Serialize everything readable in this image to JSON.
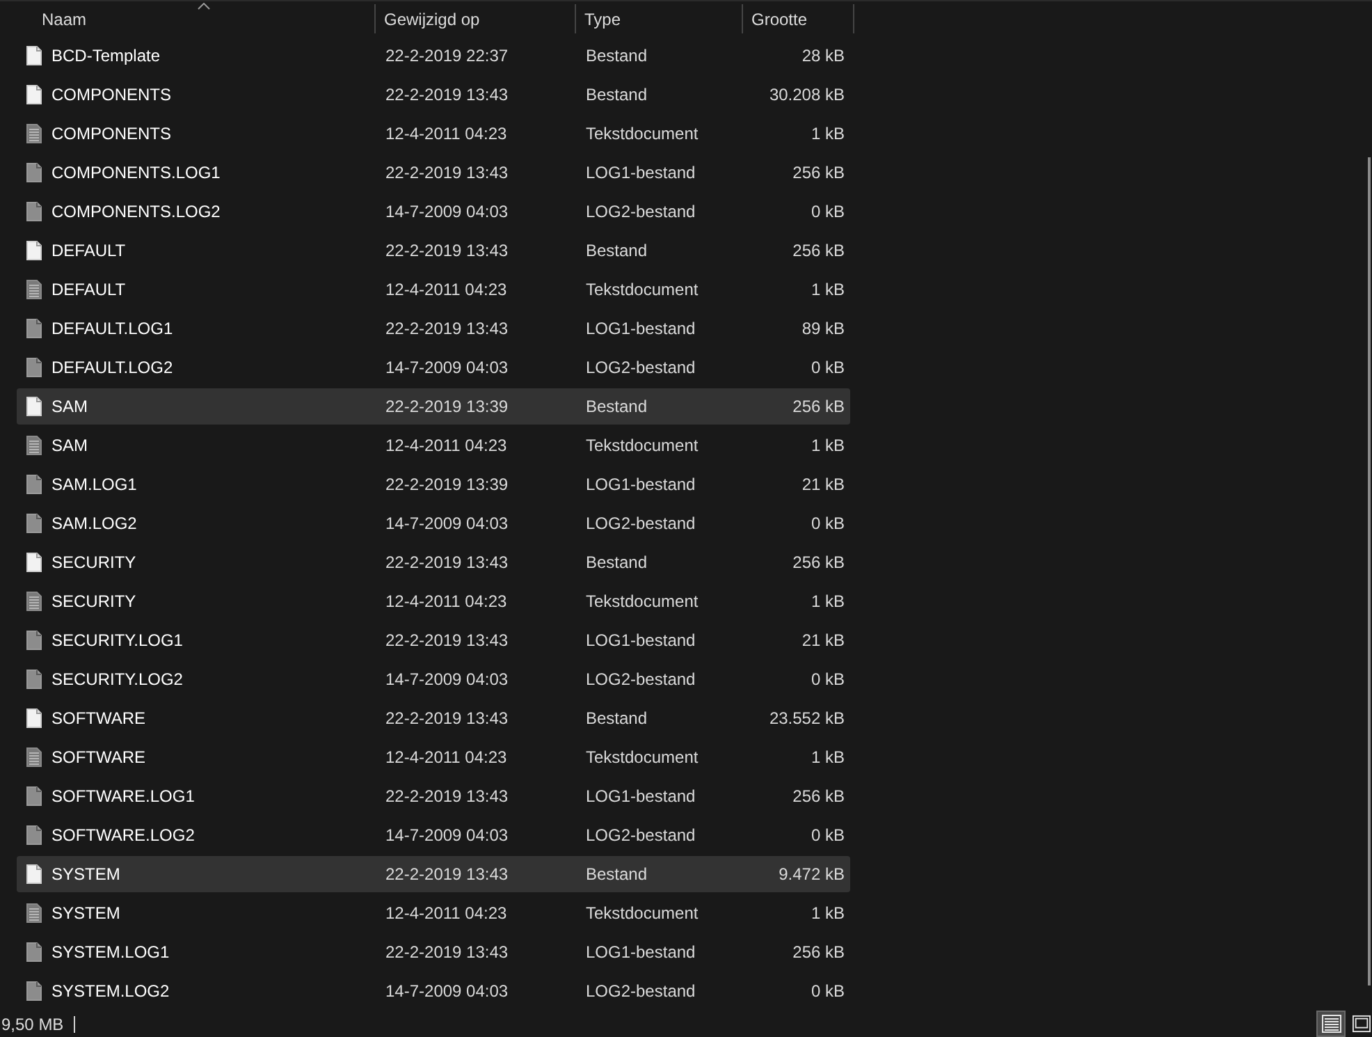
{
  "columns": [
    {
      "label": "Naam",
      "sorted": true
    },
    {
      "label": "Gewijzigd op",
      "sorted": false
    },
    {
      "label": "Type",
      "sorted": false
    },
    {
      "label": "Grootte",
      "sorted": false
    }
  ],
  "rows": [
    {
      "kind": "file",
      "name": "BCD-Template",
      "modified": "22-2-2019 22:37",
      "type": "Bestand",
      "size": "28 kB",
      "selected": false
    },
    {
      "kind": "file",
      "name": "COMPONENTS",
      "modified": "22-2-2019 13:43",
      "type": "Bestand",
      "size": "30.208 kB",
      "selected": false
    },
    {
      "kind": "text",
      "name": "COMPONENTS",
      "modified": "12-4-2011 04:23",
      "type": "Tekstdocument",
      "size": "1 kB",
      "selected": false
    },
    {
      "kind": "log",
      "name": "COMPONENTS.LOG1",
      "modified": "22-2-2019 13:43",
      "type": "LOG1-bestand",
      "size": "256 kB",
      "selected": false
    },
    {
      "kind": "log",
      "name": "COMPONENTS.LOG2",
      "modified": "14-7-2009 04:03",
      "type": "LOG2-bestand",
      "size": "0 kB",
      "selected": false
    },
    {
      "kind": "file",
      "name": "DEFAULT",
      "modified": "22-2-2019 13:43",
      "type": "Bestand",
      "size": "256 kB",
      "selected": false
    },
    {
      "kind": "text",
      "name": "DEFAULT",
      "modified": "12-4-2011 04:23",
      "type": "Tekstdocument",
      "size": "1 kB",
      "selected": false
    },
    {
      "kind": "log",
      "name": "DEFAULT.LOG1",
      "modified": "22-2-2019 13:43",
      "type": "LOG1-bestand",
      "size": "89 kB",
      "selected": false
    },
    {
      "kind": "log",
      "name": "DEFAULT.LOG2",
      "modified": "14-7-2009 04:03",
      "type": "LOG2-bestand",
      "size": "0 kB",
      "selected": false
    },
    {
      "kind": "file",
      "name": "SAM",
      "modified": "22-2-2019 13:39",
      "type": "Bestand",
      "size": "256 kB",
      "selected": true
    },
    {
      "kind": "text",
      "name": "SAM",
      "modified": "12-4-2011 04:23",
      "type": "Tekstdocument",
      "size": "1 kB",
      "selected": false
    },
    {
      "kind": "log",
      "name": "SAM.LOG1",
      "modified": "22-2-2019 13:39",
      "type": "LOG1-bestand",
      "size": "21 kB",
      "selected": false
    },
    {
      "kind": "log",
      "name": "SAM.LOG2",
      "modified": "14-7-2009 04:03",
      "type": "LOG2-bestand",
      "size": "0 kB",
      "selected": false
    },
    {
      "kind": "file",
      "name": "SECURITY",
      "modified": "22-2-2019 13:43",
      "type": "Bestand",
      "size": "256 kB",
      "selected": false
    },
    {
      "kind": "text",
      "name": "SECURITY",
      "modified": "12-4-2011 04:23",
      "type": "Tekstdocument",
      "size": "1 kB",
      "selected": false
    },
    {
      "kind": "log",
      "name": "SECURITY.LOG1",
      "modified": "22-2-2019 13:43",
      "type": "LOG1-bestand",
      "size": "21 kB",
      "selected": false
    },
    {
      "kind": "log",
      "name": "SECURITY.LOG2",
      "modified": "14-7-2009 04:03",
      "type": "LOG2-bestand",
      "size": "0 kB",
      "selected": false
    },
    {
      "kind": "file",
      "name": "SOFTWARE",
      "modified": "22-2-2019 13:43",
      "type": "Bestand",
      "size": "23.552 kB",
      "selected": false
    },
    {
      "kind": "text",
      "name": "SOFTWARE",
      "modified": "12-4-2011 04:23",
      "type": "Tekstdocument",
      "size": "1 kB",
      "selected": false
    },
    {
      "kind": "log",
      "name": "SOFTWARE.LOG1",
      "modified": "22-2-2019 13:43",
      "type": "LOG1-bestand",
      "size": "256 kB",
      "selected": false
    },
    {
      "kind": "log",
      "name": "SOFTWARE.LOG2",
      "modified": "14-7-2009 04:03",
      "type": "LOG2-bestand",
      "size": "0 kB",
      "selected": false
    },
    {
      "kind": "file",
      "name": "SYSTEM",
      "modified": "22-2-2019 13:43",
      "type": "Bestand",
      "size": "9.472 kB",
      "selected": true
    },
    {
      "kind": "text",
      "name": "SYSTEM",
      "modified": "12-4-2011 04:23",
      "type": "Tekstdocument",
      "size": "1 kB",
      "selected": false
    },
    {
      "kind": "log",
      "name": "SYSTEM.LOG1",
      "modified": "22-2-2019 13:43",
      "type": "LOG1-bestand",
      "size": "256 kB",
      "selected": false
    },
    {
      "kind": "log",
      "name": "SYSTEM.LOG2",
      "modified": "14-7-2009 04:03",
      "type": "LOG2-bestand",
      "size": "0 kB",
      "selected": false
    }
  ],
  "status_bar": {
    "size_text": "9,50 MB"
  },
  "view_buttons": [
    {
      "kind": "details",
      "selected": true
    },
    {
      "kind": "large-icons",
      "selected": false
    }
  ]
}
